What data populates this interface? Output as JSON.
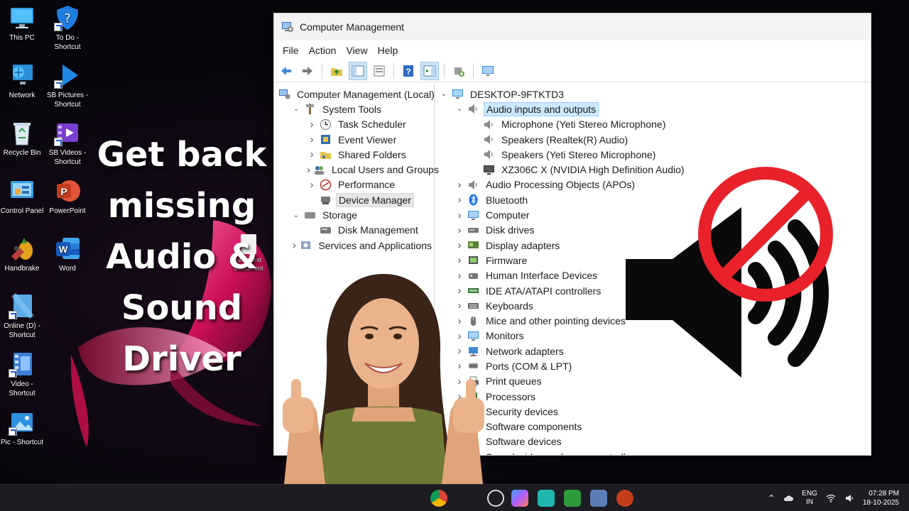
{
  "desktop": {
    "icons": [
      {
        "label": "This PC",
        "icon": "monitor-icon"
      },
      {
        "label": "To Do -\nShortcut",
        "icon": "todo-shield-icon"
      },
      {
        "label": "Network",
        "icon": "network-icon"
      },
      {
        "label": "SB Pictures -\nShortcut",
        "icon": "play-arrow-icon"
      },
      {
        "label": "Recycle Bin",
        "icon": "recycle-bin-icon"
      },
      {
        "label": "SB Videos -\nShortcut",
        "icon": "video-folder-icon"
      },
      {
        "label": "Control Panel",
        "icon": "control-panel-icon"
      },
      {
        "label": "PowerPoint",
        "icon": "powerpoint-icon"
      },
      {
        "label": "Handbrake",
        "icon": "handbrake-icon"
      },
      {
        "label": "Word",
        "icon": "word-icon"
      },
      {
        "label": "Online (D) -\nShortcut",
        "icon": "online-drive-icon"
      },
      {
        "label": "Video -\nShortcut",
        "icon": "video-file-icon"
      },
      {
        "label": "Pic - Shortcut",
        "icon": "picture-icon"
      }
    ],
    "new_text_document": "New Text Document",
    "headline": [
      "Get back",
      "missing",
      "Audio &",
      "Sound",
      "Driver"
    ]
  },
  "window": {
    "title": "Computer Management",
    "menu": [
      "File",
      "Action",
      "View",
      "Help"
    ],
    "left_tree": [
      {
        "label": "Computer Management (Local)",
        "level": 0,
        "chevron": "",
        "icon": "computer-management-icon"
      },
      {
        "label": "System Tools",
        "level": 1,
        "chevron": "down",
        "icon": "system-tools-icon"
      },
      {
        "label": "Task Scheduler",
        "level": 2,
        "chevron": "right",
        "icon": "clock-icon"
      },
      {
        "label": "Event Viewer",
        "level": 2,
        "chevron": "right",
        "icon": "event-viewer-icon"
      },
      {
        "label": "Shared Folders",
        "level": 2,
        "chevron": "right",
        "icon": "shared-folder-icon"
      },
      {
        "label": "Local Users and Groups",
        "level": 2,
        "chevron": "right",
        "icon": "users-icon"
      },
      {
        "label": "Performance",
        "level": 2,
        "chevron": "right",
        "icon": "performance-icon"
      },
      {
        "label": "Device Manager",
        "level": 2,
        "chevron": "",
        "icon": "device-manager-icon",
        "selected": true
      },
      {
        "label": "Storage",
        "level": 1,
        "chevron": "down",
        "icon": "storage-icon"
      },
      {
        "label": "Disk Management",
        "level": 2,
        "chevron": "",
        "icon": "disk-management-icon"
      },
      {
        "label": "Services and Applications",
        "level": 1,
        "chevron": "right",
        "icon": "services-icon"
      }
    ],
    "right_tree": [
      {
        "label": "DESKTOP-9FTKTD3",
        "level": 0,
        "chevron": "down",
        "icon": "computer-icon"
      },
      {
        "label": "Audio inputs and outputs",
        "level": 1,
        "chevron": "down",
        "icon": "speaker-icon",
        "selected": true
      },
      {
        "label": "Microphone (Yeti Stereo Microphone)",
        "level": 2,
        "chevron": "",
        "icon": "speaker-icon"
      },
      {
        "label": "Speakers (Realtek(R) Audio)",
        "level": 2,
        "chevron": "",
        "icon": "speaker-icon"
      },
      {
        "label": "Speakers (Yeti Stereo Microphone)",
        "level": 2,
        "chevron": "",
        "icon": "speaker-icon"
      },
      {
        "label": "XZ306C X (NVIDIA High Definition Audio)",
        "level": 2,
        "chevron": "",
        "icon": "display-monitor-icon"
      },
      {
        "label": "Audio Processing Objects (APOs)",
        "level": 1,
        "chevron": "right",
        "icon": "speaker-icon"
      },
      {
        "label": "Bluetooth",
        "level": 1,
        "chevron": "right",
        "icon": "bluetooth-icon"
      },
      {
        "label": "Computer",
        "level": 1,
        "chevron": "right",
        "icon": "computer-icon"
      },
      {
        "label": "Disk drives",
        "level": 1,
        "chevron": "right",
        "icon": "disk-drive-icon"
      },
      {
        "label": "Display adapters",
        "level": 1,
        "chevron": "right",
        "icon": "display-adapter-icon"
      },
      {
        "label": "Firmware",
        "level": 1,
        "chevron": "right",
        "icon": "firmware-icon"
      },
      {
        "label": "Human Interface Devices",
        "level": 1,
        "chevron": "right",
        "icon": "hid-icon"
      },
      {
        "label": "IDE ATA/ATAPI controllers",
        "level": 1,
        "chevron": "right",
        "icon": "ide-controller-icon"
      },
      {
        "label": "Keyboards",
        "level": 1,
        "chevron": "right",
        "icon": "keyboard-icon"
      },
      {
        "label": "Mice and other pointing devices",
        "level": 1,
        "chevron": "right",
        "icon": "mouse-icon"
      },
      {
        "label": "Monitors",
        "level": 1,
        "chevron": "right",
        "icon": "monitor-icon"
      },
      {
        "label": "Network adapters",
        "level": 1,
        "chevron": "right",
        "icon": "network-adapter-icon"
      },
      {
        "label": "Ports (COM & LPT)",
        "level": 1,
        "chevron": "right",
        "icon": "port-icon"
      },
      {
        "label": "Print queues",
        "level": 1,
        "chevron": "right",
        "icon": "printer-icon"
      },
      {
        "label": "Processors",
        "level": 1,
        "chevron": "right",
        "icon": "processor-icon"
      },
      {
        "label": "Security devices",
        "level": 1,
        "chevron": "right",
        "icon": "security-device-icon"
      },
      {
        "label": "Software components",
        "level": 1,
        "chevron": "right",
        "icon": "software-component-icon"
      },
      {
        "label": "Software devices",
        "level": 1,
        "chevron": "right",
        "icon": "software-device-icon"
      },
      {
        "label": "Sound, video and game controllers",
        "level": 1,
        "chevron": "right",
        "icon": "sound-controller-icon"
      }
    ]
  },
  "taskbar": {
    "language": "ENG",
    "region": "IN",
    "time": "07:28 PM",
    "date": "18-10-2025"
  },
  "colors": {
    "accent_blue": "#1a73e8",
    "selection_blue": "#cce8ff",
    "no_sign_red": "#e8212b"
  }
}
